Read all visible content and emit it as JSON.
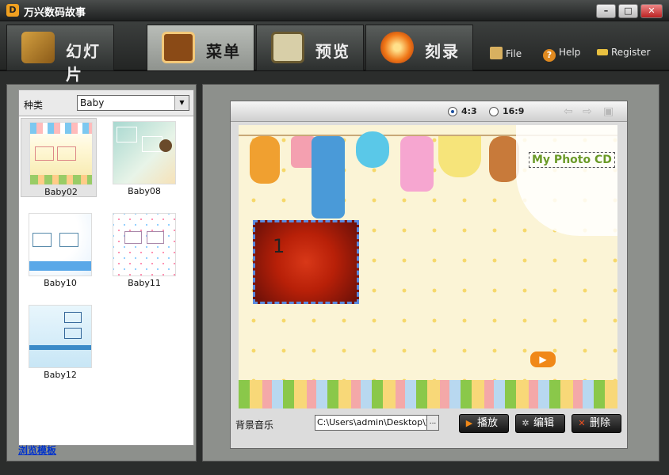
{
  "app": {
    "title": "万兴数码故事"
  },
  "tabs": [
    {
      "label": "幻灯片",
      "icon": "folder-photos-icon"
    },
    {
      "label": "菜单",
      "icon": "menu-film-icon"
    },
    {
      "label": "预览",
      "icon": "magnifier-preview-icon"
    },
    {
      "label": "刻录",
      "icon": "burn-disc-icon"
    }
  ],
  "topmenu": {
    "file": "File",
    "help": "Help",
    "register": "Register"
  },
  "category": {
    "label": "种类",
    "value": "Baby"
  },
  "templates": [
    "Baby02",
    "Baby08",
    "Baby10",
    "Baby11",
    "Baby12"
  ],
  "browse_templates": "浏览模板",
  "preview": {
    "ratio_43": "4:3",
    "ratio_169": "16:9",
    "selected_ratio": "4:3",
    "title_text": "My Photo CD",
    "photo_number": "1"
  },
  "bgm": {
    "label": "背景音乐",
    "path": "C:\\Users\\admin\\Desktop\\文件",
    "browse": "..."
  },
  "actions": {
    "play": "播放",
    "edit": "编辑",
    "delete": "删除"
  },
  "colors": {
    "accent": "#f0a020",
    "panel": "#8d908c",
    "tab_active": "#b9bdb8",
    "canvas_bg": "#fbf4d6"
  }
}
